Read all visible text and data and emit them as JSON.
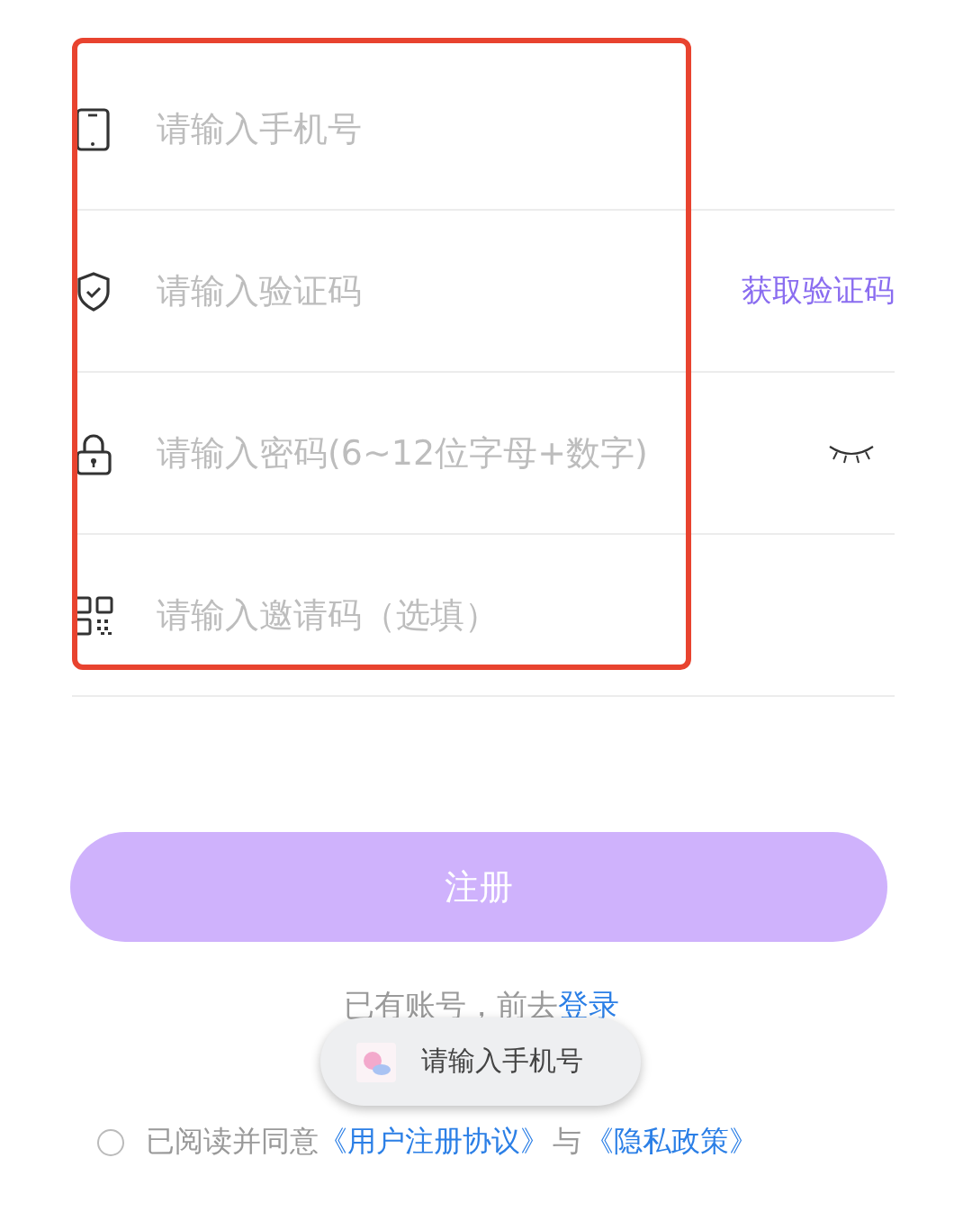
{
  "fields": [
    {
      "kind": "phone",
      "placeholder": "请输入手机号"
    },
    {
      "kind": "code",
      "placeholder": "请输入验证码",
      "action": "获取验证码"
    },
    {
      "kind": "password",
      "placeholder": "请输入密码(6~12位字母+数字)",
      "password_visible": false
    },
    {
      "kind": "invite",
      "placeholder": "请输入邀请码（选填）"
    }
  ],
  "register_button": "注册",
  "login_prompt": {
    "text": "已有账号，前去",
    "link": "登录"
  },
  "toast": {
    "text": "请输入手机号"
  },
  "agreement": {
    "checked": false,
    "text": "已阅读并同意",
    "link1": "《用户注册协议》",
    "joiner": "与",
    "link2": "《隐私政策》"
  }
}
